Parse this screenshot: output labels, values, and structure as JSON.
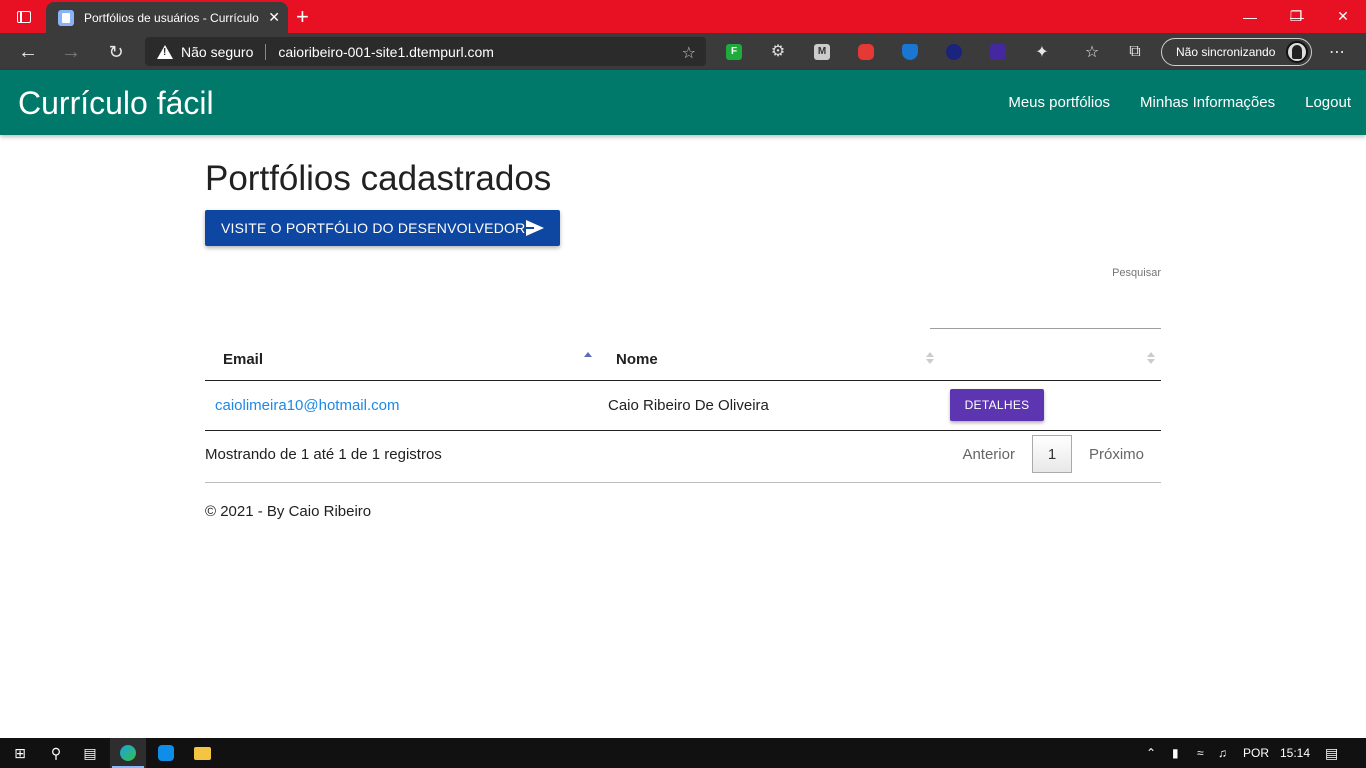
{
  "browser": {
    "tab_title": "Portfólios de usuários - Currículo fácil",
    "tab_close": "✕",
    "new_tab": "+",
    "security_label": "Não seguro",
    "url": "caioribeiro-001-site1.dtempurl.com",
    "sync_label": "Não sincronizando",
    "extension_letters": [
      "F",
      "M"
    ]
  },
  "app": {
    "brand": "Currículo fácil",
    "nav": [
      "Meus portfólios",
      "Minhas Informações",
      "Logout"
    ],
    "accent_color": "#00796b"
  },
  "main": {
    "title": "Portfólios cadastrados",
    "dev_button": "VISITE O PORTFÓLIO DO DESENVOLVEDOR!",
    "search_label": "Pesquisar",
    "table": {
      "headers": [
        "Email",
        "Nome",
        ""
      ],
      "rows": [
        {
          "email": "caiolimeira10@hotmail.com",
          "nome": "Caio Ribeiro De Oliveira",
          "action": "DETALHES"
        }
      ]
    },
    "info": "Mostrando de 1 até 1 de 1 registros",
    "pagination": {
      "prev": "Anterior",
      "current": "1",
      "next": "Próximo"
    },
    "footer": "© 2021 - By Caio Ribeiro"
  },
  "taskbar": {
    "lang": "POR",
    "time": "15:14"
  }
}
